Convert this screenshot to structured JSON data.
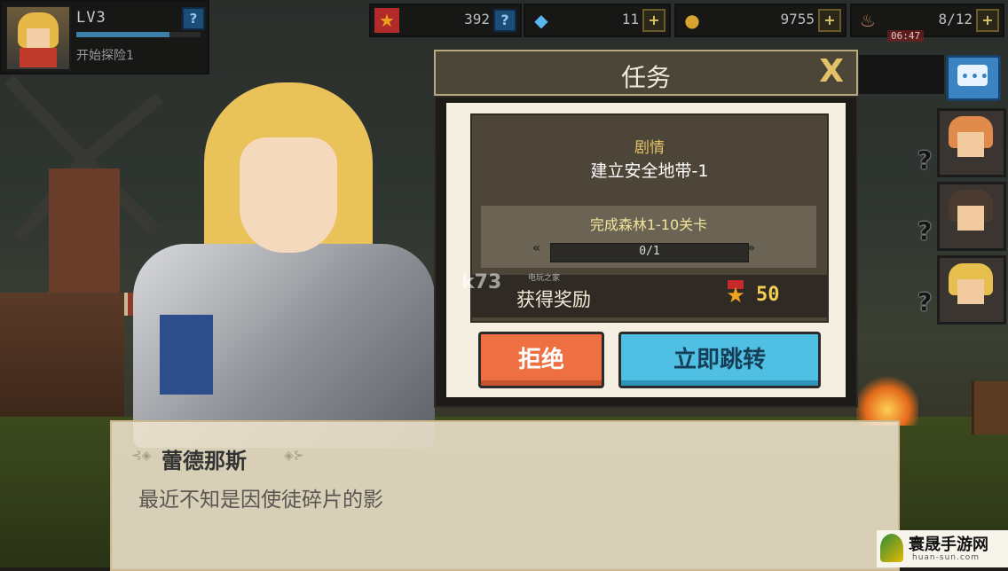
{
  "player": {
    "level": "LV3",
    "quest_hint": "开始探险1",
    "help_icon": "?",
    "xp_progress": 0.75
  },
  "resources": [
    {
      "name": "medal",
      "icon": "★",
      "value": "392",
      "button": "?"
    },
    {
      "name": "diamond",
      "icon": "◆",
      "value": "11",
      "button": "+"
    },
    {
      "name": "gold",
      "icon": "●",
      "value": "9755",
      "button": "+"
    },
    {
      "name": "stamina",
      "icon": "♨",
      "value": "8/12",
      "button": "+"
    }
  ],
  "stamina_timer": "06:47",
  "side_heroes": {
    "question_icon": "?"
  },
  "mission": {
    "title": "任务",
    "close_icon": "X",
    "category": "剧情",
    "quest_name": "建立安全地带-1",
    "objective": "完成森林1-10关卡",
    "progress_text": "0/1",
    "progress": 0,
    "reward_label": "获得奖励",
    "reward_value": "50",
    "refuse_label": "拒绝",
    "go_label": "立即跳转"
  },
  "watermark": {
    "text": "k73",
    "sub": "电玩之家"
  },
  "dialogue": {
    "speaker": "蕾德那斯",
    "line": "最近不知是因使徒碎片的影"
  },
  "corner_logo": {
    "text": "寰晟手游网",
    "sub": "huan-sun.com"
  },
  "colors": {
    "accent_gold": "#e4c267",
    "refuse": "#ee7042",
    "go": "#4fc0e3"
  }
}
